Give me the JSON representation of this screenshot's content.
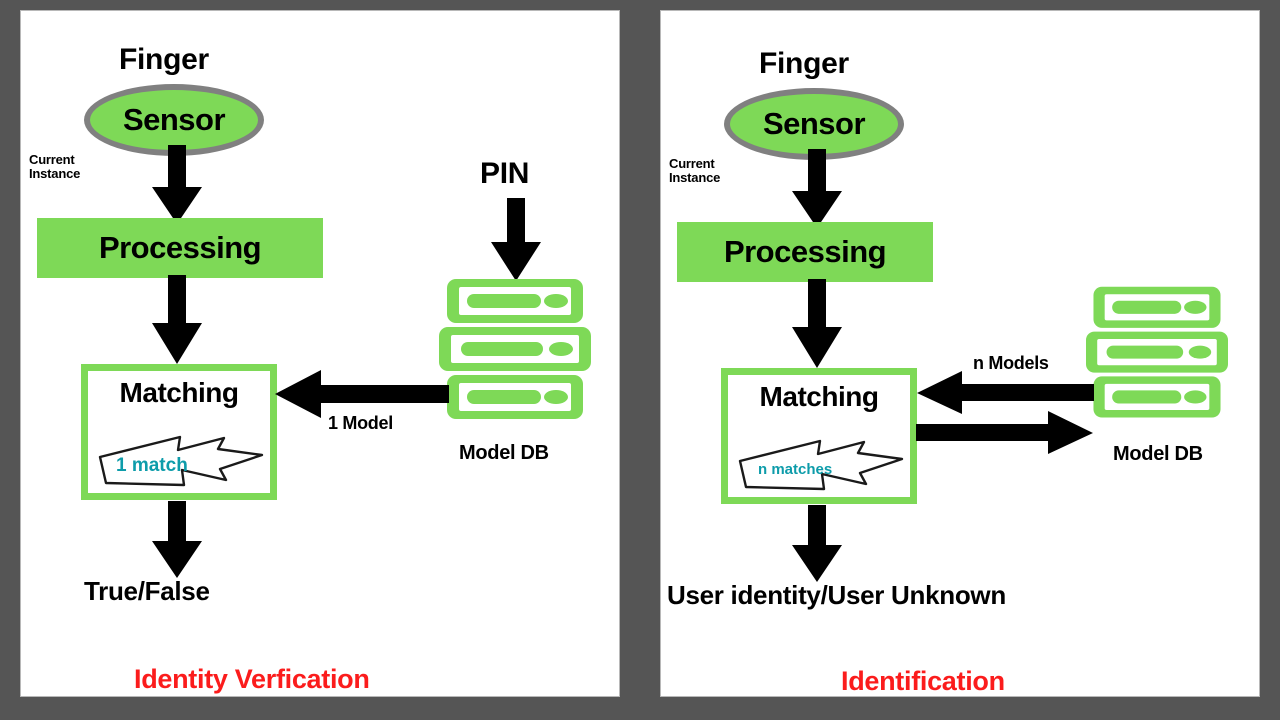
{
  "theme": {
    "background": "#555555",
    "panel_bg": "#ffffff",
    "green": "#7ed957",
    "gray_outline": "#808080",
    "teal": "#0d9caa",
    "red": "#fb1c1c",
    "black": "#000000"
  },
  "left_panel": {
    "title": "Identity Verfication",
    "finger_label": "Finger",
    "sensor_label": "Sensor",
    "current_instance_label": "Current\nInstance",
    "processing_label": "Processing",
    "matching_label": "Matching",
    "sketch_label": "1 match",
    "pin_label": "PIN",
    "db_label": "Model DB",
    "db_edge_label": "1 Model",
    "output_label": "True/False"
  },
  "right_panel": {
    "title": "Identification",
    "finger_label": "Finger",
    "sensor_label": "Sensor",
    "current_instance_label": "Current\nInstance",
    "processing_label": "Processing",
    "matching_label": "Matching",
    "sketch_label": "n matches",
    "db_label": "Model DB",
    "db_edge_label": "n Models",
    "output_label": "User identity/User Unknown"
  }
}
